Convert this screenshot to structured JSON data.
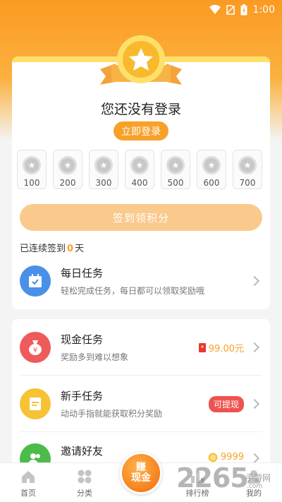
{
  "status_bar": {
    "time": "1:00"
  },
  "login": {
    "title": "您还没有登录",
    "button": "立即登录"
  },
  "checkin": {
    "days": [
      "100",
      "200",
      "300",
      "400",
      "500",
      "600",
      "700"
    ],
    "button": "签到领积分",
    "streak_prefix": "已连续签到",
    "streak_count": "0",
    "streak_suffix": "天"
  },
  "daily_task": {
    "title": "每日任务",
    "subtitle": "轻松完成任务，每日都可以领取奖励哦"
  },
  "tasks": [
    {
      "title": "现金任务",
      "subtitle": "奖励多到难以想象",
      "value": "99.00元"
    },
    {
      "title": "新手任务",
      "subtitle": "动动手指就能获取积分奖励",
      "tag": "可提现"
    },
    {
      "title": "邀请好友",
      "value": "9999"
    }
  ],
  "nav": {
    "home": "首页",
    "category": "分类",
    "earn_line1": "赚",
    "earn_line2": "现金",
    "ranking": "排行榜",
    "mine": "我的"
  },
  "watermark": {
    "brand": "2265",
    "site": "手游网",
    "domain": ".com"
  },
  "colors": {
    "accent": "#f7a12a",
    "hero": "#fb9a22",
    "red": "#ef5350",
    "blue": "#4a90e8"
  }
}
